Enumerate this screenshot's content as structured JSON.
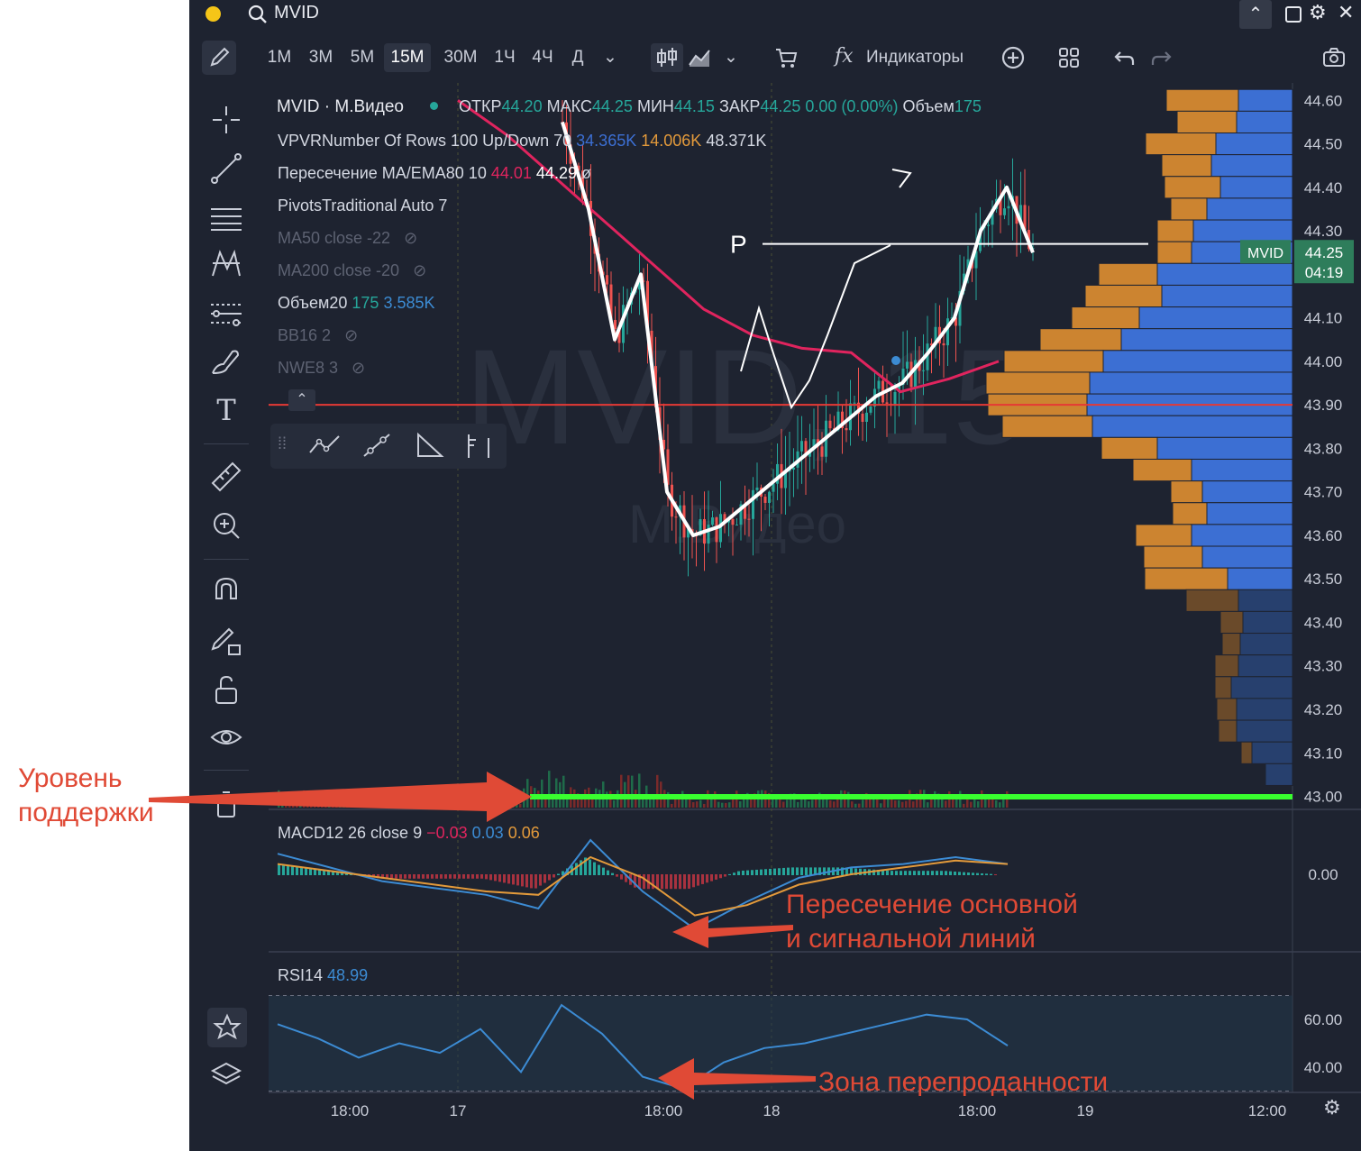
{
  "titlebar": {
    "symbol": "MVID"
  },
  "toolbar": {
    "timeframes": [
      "1М",
      "3М",
      "5М",
      "15М",
      "30М",
      "1Ч",
      "4Ч",
      "Д"
    ],
    "active_timeframe": "15М",
    "indicators_label": "Индикаторы"
  },
  "watermark": {
    "big": "MVID, 15",
    "small": "М.Видео"
  },
  "legend": {
    "main": {
      "symbol": "MVID · М.Видео",
      "open_label": "ОТКР",
      "open": "44.20",
      "high_label": "МАКС",
      "high": "44.25",
      "low_label": "МИН",
      "low": "44.15",
      "close_label": "ЗАКР",
      "close": "44.25",
      "change": "0.00 (0.00%)",
      "volume_label": "Объем",
      "volume": "175"
    },
    "vpvr": {
      "label": "VPVRNumber Of Rows 100 Up/Down 70",
      "up": "34.365K",
      "down": "14.006K",
      "total": "48.371K"
    },
    "cross": {
      "label": "Пересечение MA/EMA80 10",
      "v1": "44.01",
      "v2": "44.29",
      "v3": "ø"
    },
    "pivots": {
      "label": "PivotsTraditional Auto 7"
    },
    "ma50": {
      "label": "MA50 close -22"
    },
    "ma200": {
      "label": "MA200 close -20"
    },
    "vol20": {
      "label": "Объем20",
      "v1": "175",
      "v2": "3.585K"
    },
    "bb": {
      "label": "BB16 2"
    },
    "nwe": {
      "label": "NWE8 3"
    },
    "macd": {
      "label": "MACD12 26 close 9",
      "v1": "−0.03",
      "v2": "0.03",
      "v3": "0.06"
    },
    "rsi": {
      "label": "RSI14",
      "value": "48.99"
    }
  },
  "price_axis": {
    "ticks": [
      "44.60",
      "44.50",
      "44.40",
      "44.30",
      "44.10",
      "44.00",
      "43.90",
      "43.80",
      "43.70",
      "43.60",
      "43.50",
      "43.40",
      "43.30",
      "43.20",
      "43.10",
      "43.00"
    ],
    "last_label": "MVID",
    "last_price": "44.25",
    "countdown": "04:19"
  },
  "macd_axis": {
    "ticks": [
      "0.00"
    ]
  },
  "rsi_axis": {
    "ticks": [
      "60.00",
      "40.00"
    ]
  },
  "time_axis": {
    "ticks": [
      "18:00",
      "17",
      "18:00",
      "18",
      "18:00",
      "19",
      "12:00"
    ]
  },
  "drawing": {
    "p_label": "P"
  },
  "annotations": {
    "support": [
      "Уровень",
      "поддержки"
    ],
    "crossing": [
      "Пересечение основной",
      "и сигнальной линий"
    ],
    "oversold": [
      "Зона перепроданности"
    ]
  },
  "colors": {
    "up": "#26a69a",
    "down": "#ef5350",
    "bg": "#1e2330",
    "annotation": "#e04a36",
    "support": "#39ff2f",
    "level": "#e53935",
    "vp_up": "#3c6fd3",
    "vp_down": "#cc8430"
  },
  "chart_data": [
    {
      "type": "candlestick",
      "title": "MVID · М.Видео",
      "ylim": [
        42.97,
        44.64
      ],
      "close_path": [
        {
          "t": "17 08:00",
          "y": 44.55
        },
        {
          "t": "17 10:00",
          "y": 44.35
        },
        {
          "t": "17 12:00",
          "y": 44.05
        },
        {
          "t": "17 14:00",
          "y": 44.2
        },
        {
          "t": "17 16:00",
          "y": 43.7
        },
        {
          "t": "17 18:00",
          "y": 43.6
        },
        {
          "t": "17 20:00",
          "y": 43.62
        },
        {
          "t": "18 08:00",
          "y": 43.92
        },
        {
          "t": "18 10:00",
          "y": 43.95
        },
        {
          "t": "18 12:00",
          "y": 44.02
        },
        {
          "t": "18 14:00",
          "y": 44.1
        },
        {
          "t": "18 16:00",
          "y": 44.3
        },
        {
          "t": "18 18:00",
          "y": 44.4
        },
        {
          "t": "18 20:00",
          "y": 44.25
        }
      ],
      "series": [
        {
          "name": "MA/EMA80",
          "values": [
            44.6,
            44.52,
            44.42,
            44.32,
            44.22,
            44.12,
            44.06,
            44.03,
            44.02,
            43.93,
            43.96,
            44.0
          ]
        }
      ],
      "levels": [
        {
          "name": "P",
          "y": 44.27
        },
        {
          "name": "support",
          "y": 43.9
        }
      ],
      "volume_profile": [
        {
          "price": 44.6,
          "up": 60,
          "down": 80
        },
        {
          "price": 44.55,
          "up": 62,
          "down": 66
        },
        {
          "price": 44.5,
          "up": 85,
          "down": 78
        },
        {
          "price": 44.45,
          "up": 90,
          "down": 55
        },
        {
          "price": 44.4,
          "up": 80,
          "down": 62
        },
        {
          "price": 44.35,
          "up": 95,
          "down": 40
        },
        {
          "price": 44.3,
          "up": 110,
          "down": 40
        },
        {
          "price": 44.25,
          "up": 112,
          "down": 38
        },
        {
          "price": 44.2,
          "up": 150,
          "down": 65
        },
        {
          "price": 44.15,
          "up": 145,
          "down": 85
        },
        {
          "price": 44.1,
          "up": 170,
          "down": 75
        },
        {
          "price": 44.05,
          "up": 190,
          "down": 90
        },
        {
          "price": 44.0,
          "up": 210,
          "down": 110
        },
        {
          "price": 43.95,
          "up": 225,
          "down": 115
        },
        {
          "price": 43.9,
          "up": 228,
          "down": 110
        },
        {
          "price": 43.85,
          "up": 222,
          "down": 100
        },
        {
          "price": 43.8,
          "up": 150,
          "down": 62
        },
        {
          "price": 43.75,
          "up": 112,
          "down": 65
        },
        {
          "price": 43.7,
          "up": 100,
          "down": 35
        },
        {
          "price": 43.65,
          "up": 95,
          "down": 38
        },
        {
          "price": 43.6,
          "up": 112,
          "down": 62
        },
        {
          "price": 43.55,
          "up": 100,
          "down": 65
        },
        {
          "price": 43.5,
          "up": 72,
          "down": 92
        },
        {
          "price": 43.45,
          "up": 60,
          "down": 58
        },
        {
          "price": 43.4,
          "up": 55,
          "down": 25
        },
        {
          "price": 43.35,
          "up": 58,
          "down": 20
        },
        {
          "price": 43.3,
          "up": 60,
          "down": 26
        },
        {
          "price": 43.25,
          "up": 68,
          "down": 18
        },
        {
          "price": 43.2,
          "up": 62,
          "down": 22
        },
        {
          "price": 43.15,
          "up": 62,
          "down": 20
        },
        {
          "price": 43.1,
          "up": 45,
          "down": 12
        },
        {
          "price": 43.05,
          "up": 30,
          "down": 0
        }
      ]
    },
    {
      "type": "line",
      "title": "MACD12 26 close 9",
      "series": [
        {
          "name": "MACD",
          "values": [
            0.06,
            0.02,
            -0.02,
            -0.04,
            -0.06,
            -0.1,
            0.1,
            -0.05,
            -0.16,
            -0.08,
            -0.01,
            0.02,
            0.03,
            0.05,
            0.03
          ]
        },
        {
          "name": "Signal",
          "values": [
            0.03,
            0.01,
            -0.01,
            -0.03,
            -0.05,
            -0.06,
            0.05,
            -0.01,
            -0.12,
            -0.09,
            -0.03,
            0.0,
            0.02,
            0.04,
            0.03
          ]
        }
      ]
    },
    {
      "type": "line",
      "title": "RSI14",
      "ylim": [
        30,
        70
      ],
      "series": [
        {
          "name": "RSI14",
          "values": [
            58,
            52,
            44,
            50,
            46,
            56,
            38,
            66,
            54,
            36,
            31,
            42,
            48,
            50,
            54,
            58,
            62,
            60,
            49
          ]
        }
      ]
    }
  ]
}
